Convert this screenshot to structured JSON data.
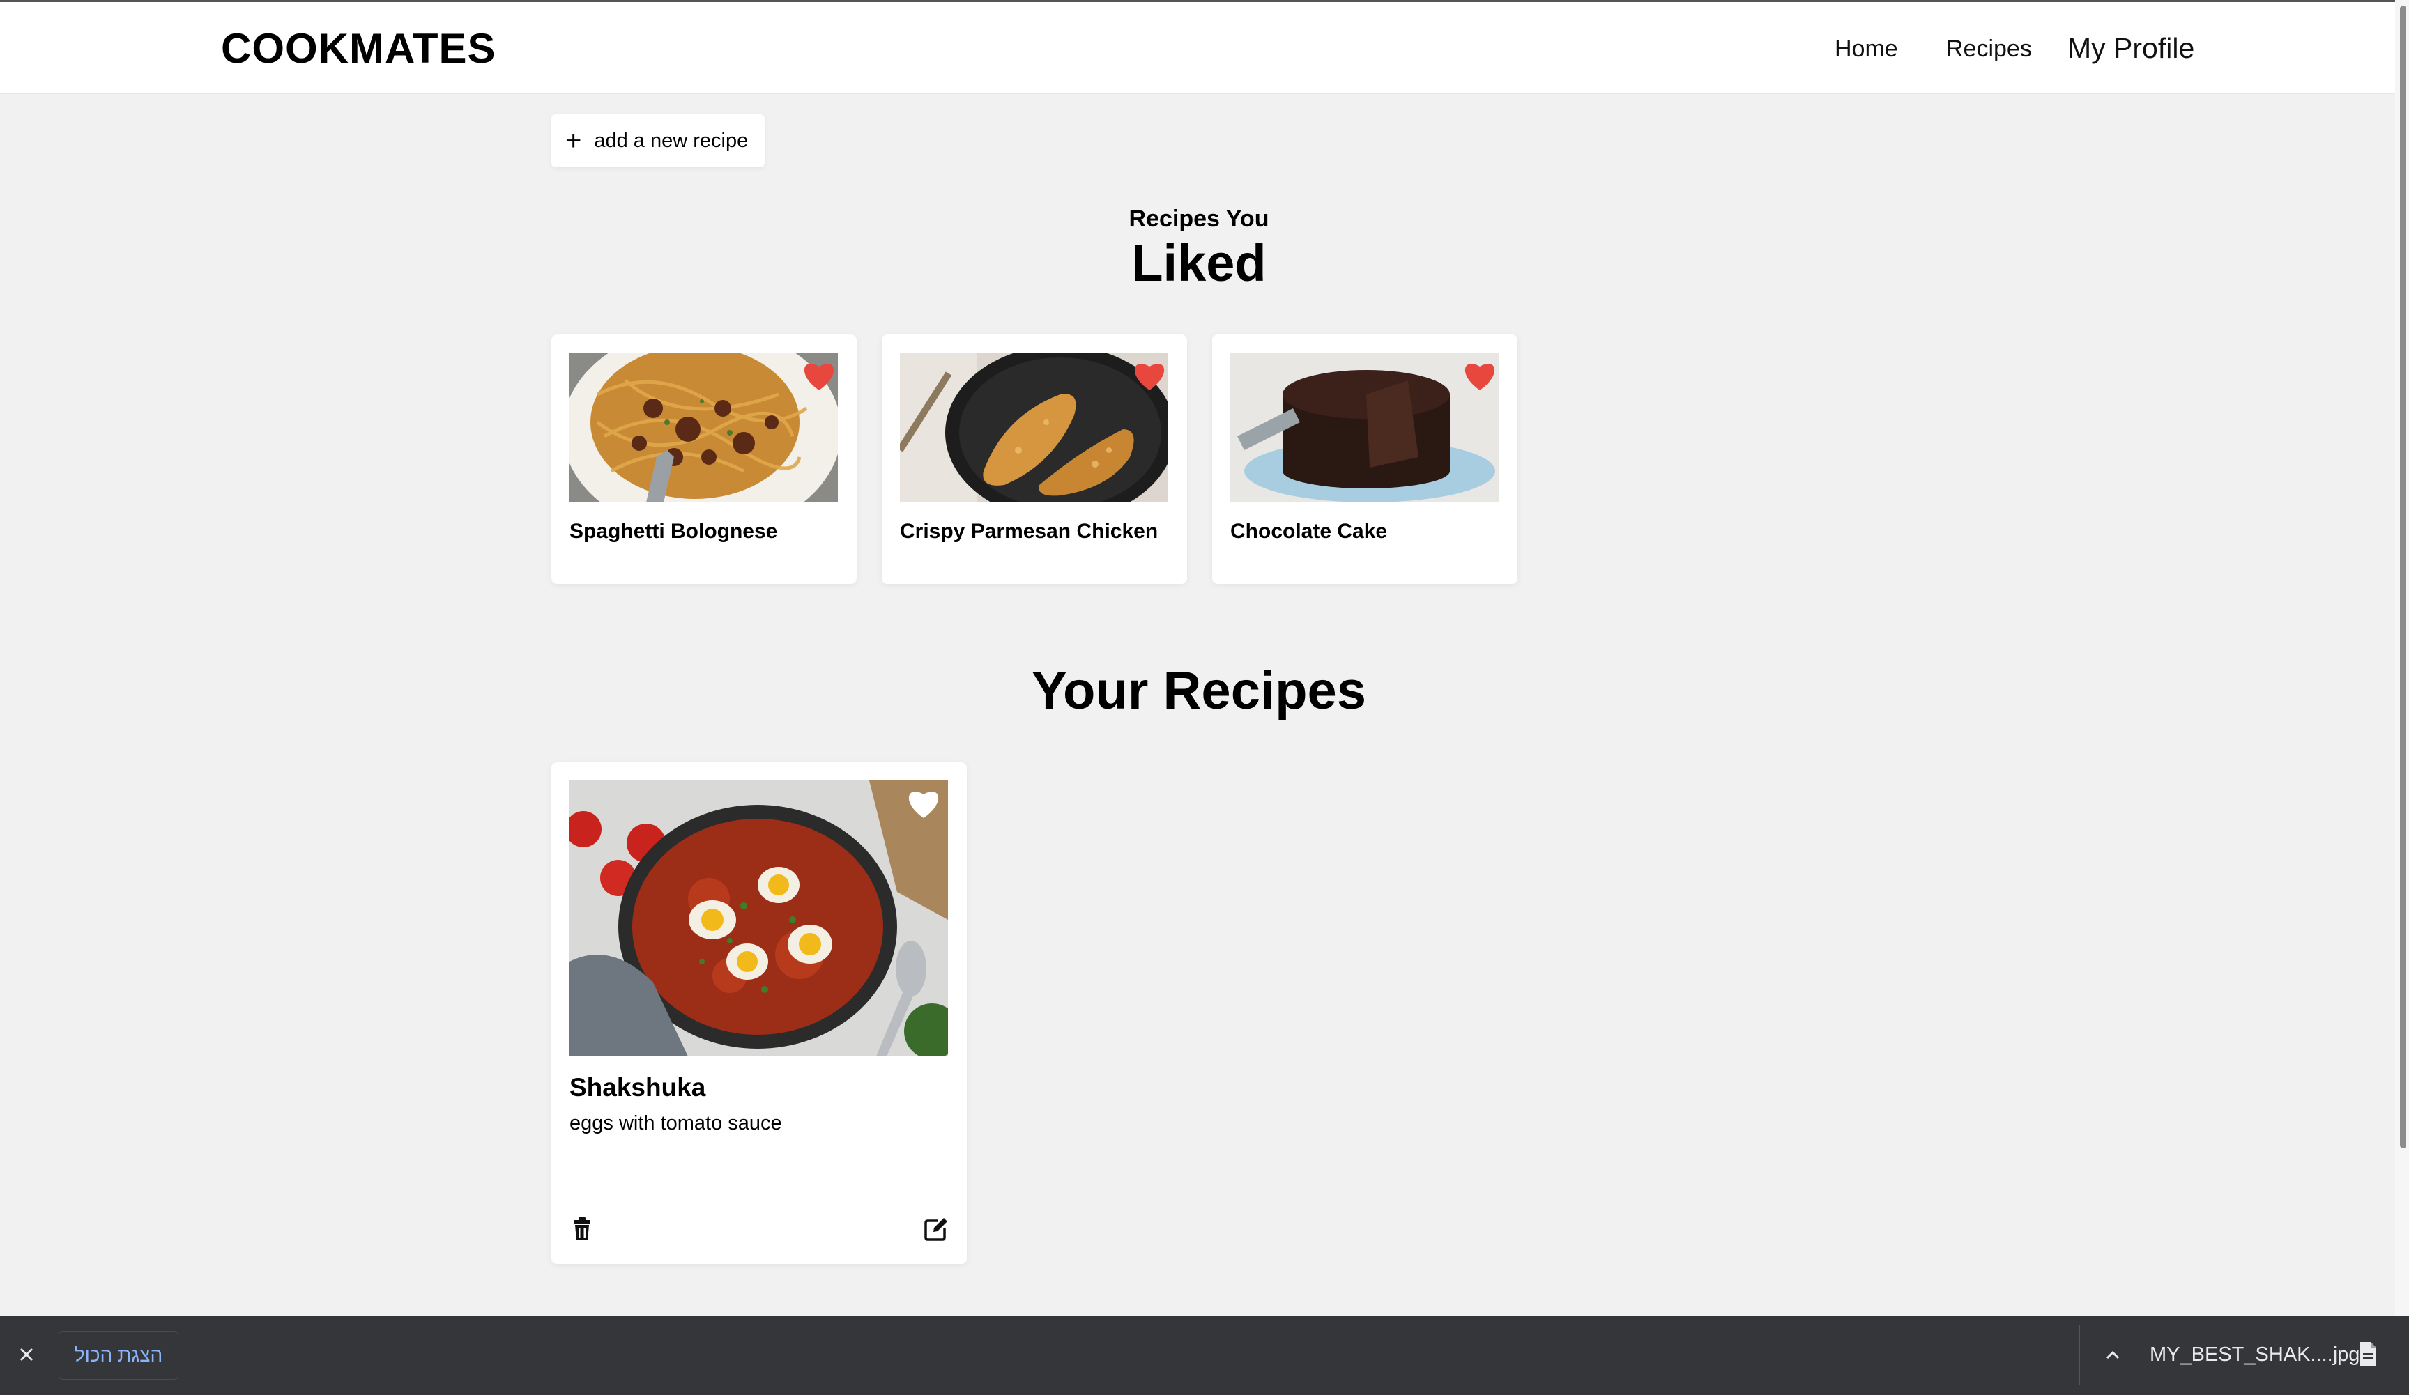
{
  "header": {
    "logo": "COOKMATES",
    "nav": {
      "home": "Home",
      "recipes": "Recipes",
      "profile": "My Profile"
    }
  },
  "actions": {
    "add_recipe": "add a new recipe"
  },
  "liked_section": {
    "subtitle": "Recipes You",
    "title": "Liked",
    "cards": [
      {
        "name": "Spaghetti Bolognese",
        "liked": true
      },
      {
        "name": "Crispy Parmesan Chicken",
        "liked": true
      },
      {
        "name": "Chocolate Cake",
        "liked": true
      }
    ]
  },
  "your_section": {
    "title": "Your Recipes",
    "cards": [
      {
        "name": "Shakshuka",
        "description": "eggs with tomato sauce",
        "liked": false
      }
    ]
  },
  "download_bar": {
    "show_all": "הצגת הכול",
    "file_name": "MY_BEST_SHAK....jpg"
  },
  "colors": {
    "heart_liked": "#e8473e",
    "heart_unliked": "#ffffff",
    "download_bar_bg": "#35363a",
    "link_blue": "#8ab4f8"
  }
}
